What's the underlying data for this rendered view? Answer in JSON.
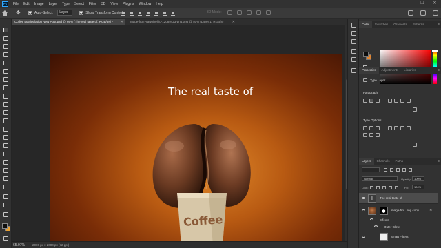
{
  "app": {
    "logo": "Ps",
    "menu": [
      "File",
      "Edit",
      "Image",
      "Layer",
      "Type",
      "Select",
      "Filter",
      "3D",
      "View",
      "Plugins",
      "Window",
      "Help"
    ],
    "window_controls": [
      "—",
      "❐",
      "✕"
    ]
  },
  "options_bar": {
    "move_icon": "move-tool-icon",
    "auto_select_label": "Auto-Select:",
    "auto_select_target": "Layer",
    "show_transform_label": "Show Transform Controls",
    "mode_3d_label": "3D Mode:"
  },
  "tabs": [
    {
      "title": "Coffee Manipulation New Post.psd @ 66% (The real taste of, RGB/8#) *",
      "close": "✕"
    },
    {
      "title": "image-from-rawpixel-id-12089423-png.png @ 50% (Layer 1, RGB/8)",
      "close": "✕"
    }
  ],
  "canvas": {
    "headline": "The real taste of",
    "cup_text": "Coffee"
  },
  "status": {
    "zoom": "65.97%",
    "doc_info": "2000 px x 2000 px (72 ppi)"
  },
  "color_panel": {
    "tabs": [
      "Color",
      "Swatches",
      "Gradients",
      "Patterns"
    ],
    "foreground": "#0d0d0d",
    "background": "#e08430"
  },
  "properties_panel": {
    "tabs": [
      "Properties",
      "Adjustments",
      "Libraries"
    ],
    "layer_kind": "Type Layer",
    "paragraph_label": "Paragraph",
    "type_options_label": "Type Options"
  },
  "layers_panel": {
    "tabs": [
      "Layers",
      "Channels",
      "Paths"
    ],
    "blend_mode": "Normal",
    "opacity_label": "Opacity:",
    "opacity_value": "100%",
    "lock_label": "Lock:",
    "fill_label": "Fill:",
    "fill_value": "100%",
    "layers": [
      {
        "name": "The real taste of",
        "kind": "type",
        "selected": true
      },
      {
        "name": "image-fro...png copy",
        "kind": "image",
        "fx": "fx"
      },
      {
        "name": "Effects",
        "kind": "sub"
      },
      {
        "name": "Outer Glow",
        "kind": "sub"
      },
      {
        "name": "Smart Filters",
        "kind": "filter"
      }
    ]
  }
}
